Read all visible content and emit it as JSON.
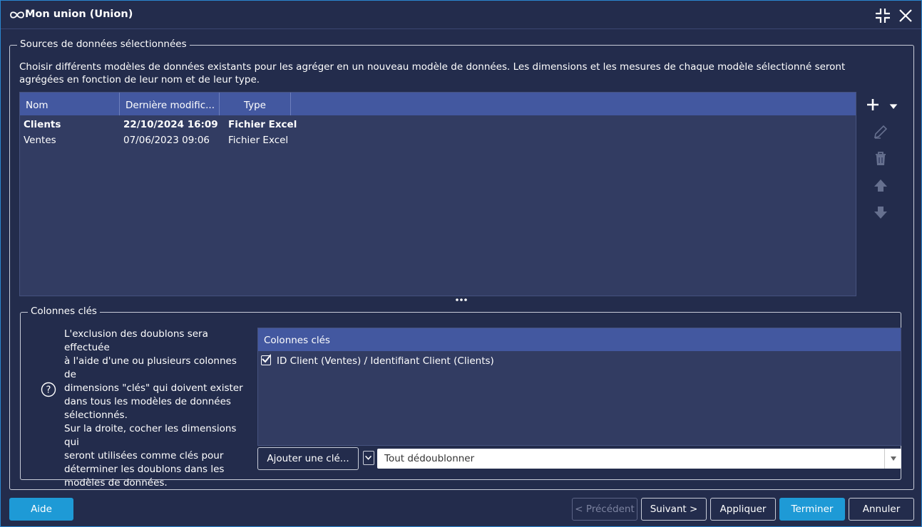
{
  "window": {
    "title": "Mon union (Union)",
    "icon": "infinity-icon",
    "controls": [
      "collapse-icon",
      "close-icon"
    ]
  },
  "sources": {
    "legend": "Sources de données sélectionnées",
    "description": "Choisir différents modèles de données existants pour les agréger en un nouveau modèle de données. Les dimensions et les mesures de chaque modèle sélectionné seront agrégées en fonction de leur nom et de leur type.",
    "columns": [
      "Nom",
      "Dernière modific...",
      "Type"
    ],
    "rows": [
      {
        "nom": "Clients",
        "date": "22/10/2024 16:09",
        "type": "Fichier Excel",
        "bold": true
      },
      {
        "nom": "Ventes",
        "date": "07/06/2023 09:06",
        "type": "Fichier Excel",
        "bold": false
      }
    ],
    "tools": [
      "add-icon",
      "edit-icon",
      "delete-icon",
      "move-up-icon",
      "move-down-icon"
    ]
  },
  "keys": {
    "legend": "Colonnes clés",
    "help": "L'exclusion des doublons sera effectuée\nà l'aide d'une ou plusieurs colonnes de\ndimensions \"clés\" qui doivent exister\ndans tous les modèles de données\nsélectionnés.\nSur la droite, cocher les dimensions qui\nseront utilisées comme clés pour\ndéterminer les doublons dans les\nmodèles de données.",
    "list_header": "Colonnes clés",
    "items": [
      {
        "label": "ID Client (Ventes) / Identifiant Client (Clients)",
        "checked": true
      }
    ],
    "add_button": "Ajouter une clé...",
    "dedupe_value": "Tout dédoublonner"
  },
  "footer": {
    "help": "Aide",
    "previous": "< Précédent",
    "next": "Suivant >",
    "apply": "Appliquer",
    "finish": "Terminer",
    "cancel": "Annuler"
  },
  "colors": {
    "background": "#232c4c",
    "header": "#4358a0",
    "accent": "#1e9ad6",
    "border": "#2a86d0"
  }
}
